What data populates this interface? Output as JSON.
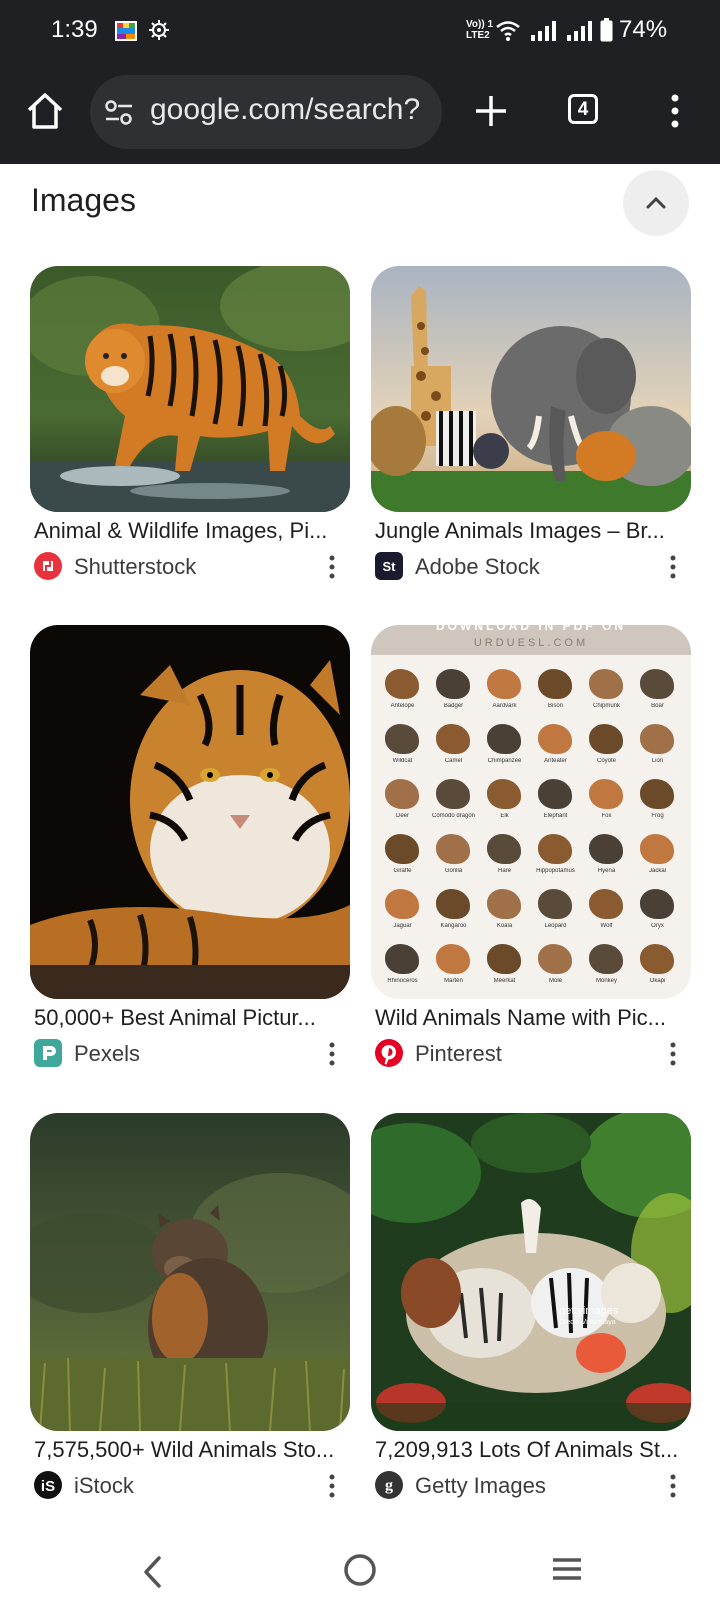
{
  "status": {
    "time": "1:39",
    "volte_line1": "Vo)) 1",
    "volte_line2": "LTE2",
    "battery": "74%"
  },
  "toolbar": {
    "url": "google.com/search?",
    "tab_count": "4"
  },
  "section": {
    "title": "Images"
  },
  "results": [
    {
      "title": "Animal & Wildlife Images, Pi...",
      "source": "Shutterstock",
      "icon": "shutterstock-icon",
      "accent": "#e8333c"
    },
    {
      "title": "Jungle Animals Images – Br...",
      "source": "Adobe Stock",
      "icon": "adobe-stock-icon",
      "accent": "#1b1b2f"
    },
    {
      "title": "50,000+ Best Animal Pictur...",
      "source": "Pexels",
      "icon": "pexels-icon",
      "accent": "#3fa89a"
    },
    {
      "title": "Wild Animals Name with Pic...",
      "source": "Pinterest",
      "icon": "pinterest-icon",
      "accent": "#e60023"
    },
    {
      "title": "7,575,500+ Wild Animals Sto...",
      "source": "iStock",
      "icon": "istock-icon",
      "accent": "#111111"
    },
    {
      "title": "7,209,913 Lots Of Animals St...",
      "source": "Getty Images",
      "icon": "getty-images-icon",
      "accent": "#333333"
    }
  ],
  "poster": {
    "header": "DOWNLOAD IN PDF ON",
    "site": "URDUESL.COM",
    "labels": [
      "Antelope",
      "Badger",
      "Aardvark",
      "Bison",
      "Chipmunk",
      "Boar",
      "Wildcat",
      "Camel",
      "Chimpanzee",
      "Anteater",
      "Coyote",
      "Lion",
      "Deer",
      "Comodo dragon",
      "Elk",
      "Elephant",
      "Fox",
      "Frog",
      "Giraffe",
      "Gorilla",
      "Hare",
      "Hippopotamus",
      "Hyena",
      "Jackal",
      "Jaguar",
      "Kangaroo",
      "Koala",
      "Leopard",
      "Wolf",
      "Oryx",
      "Rhinoceros",
      "Marten",
      "Meerkat",
      "Mole",
      "Monkey",
      "Okapi"
    ]
  },
  "watermark": {
    "brand": "gettyimages",
    "credit": "Credit: Vizerskaya"
  }
}
